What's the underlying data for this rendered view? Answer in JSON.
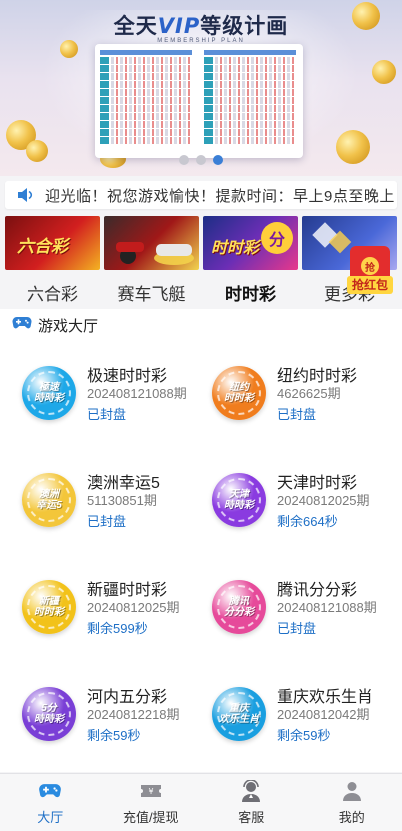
{
  "banner": {
    "title_prefix": "全天",
    "title_vip": "VIP",
    "title_suffix": "等级计画",
    "subtitle": "MEMBERSHIP PLAN",
    "slide_count": 3,
    "active_slide": 3
  },
  "notice": {
    "icon": "speaker-icon",
    "text": "迎光临！祝您游戏愉快！提款时间：早上9点至晚上"
  },
  "categories": [
    {
      "label": "六合彩",
      "image_text": "六合彩",
      "active": false
    },
    {
      "label": "赛车飞艇",
      "image_text": "",
      "active": false
    },
    {
      "label": "时时彩",
      "image_text": "时时彩",
      "active": true
    },
    {
      "label": "更多彩",
      "image_text": "",
      "active": false
    }
  ],
  "red_packet": {
    "label": "抢红包",
    "seal": "抢"
  },
  "hall": {
    "title": "游戏大厅",
    "icon": "gamepad-icon",
    "games": [
      {
        "name": "极速时时彩",
        "issue": "20240812108​8期",
        "status": "已封盘",
        "logo_text": "極速\n時時彩",
        "color": "#1ea8e8"
      },
      {
        "name": "纽约时时彩",
        "issue": "4626625期",
        "status": "已封盘",
        "logo_text": "纽约\n时时彩",
        "color": "#f07d1e"
      },
      {
        "name": "澳洲幸运5",
        "issue": "51130851期",
        "status": "已封盘",
        "logo_text": "澳洲\n幸运5",
        "color": "#f3c63a"
      },
      {
        "name": "天津时时彩",
        "issue": "20240812025期",
        "status": "剩余664秒",
        "logo_text": "天津\n時時彩",
        "color": "#8a3be0"
      },
      {
        "name": "新疆时时彩",
        "issue": "20240812025期",
        "status": "剩余599秒",
        "logo_text": "新疆\n时时彩",
        "color": "#f2c21a"
      },
      {
        "name": "腾讯分分彩",
        "issue": "202408121088期",
        "status": "已封盘",
        "logo_text": "腾讯\n分分彩",
        "color": "#e64a9a"
      },
      {
        "name": "河内五分彩",
        "issue": "20240812218期",
        "status": "剩余59秒",
        "logo_text": "5分\n時時彩",
        "color": "#7a3fd6"
      },
      {
        "name": "重庆欢乐生肖",
        "issue": "20240812042期",
        "status": "剩余59秒",
        "logo_text": "重庆\n欢乐生肖",
        "color": "#1a9fe0"
      }
    ]
  },
  "tabbar": [
    {
      "label": "大厅",
      "icon": "gamepad-icon",
      "active": true
    },
    {
      "label": "充值/提现",
      "icon": "ticket-icon",
      "active": false
    },
    {
      "label": "客服",
      "icon": "support-agent-icon",
      "active": false
    },
    {
      "label": "我的",
      "icon": "user-icon",
      "active": false
    }
  ],
  "colors": {
    "accent": "#1e6fc6",
    "active_dot": "#3a7fd6",
    "countdown": "#1e6fc6"
  }
}
